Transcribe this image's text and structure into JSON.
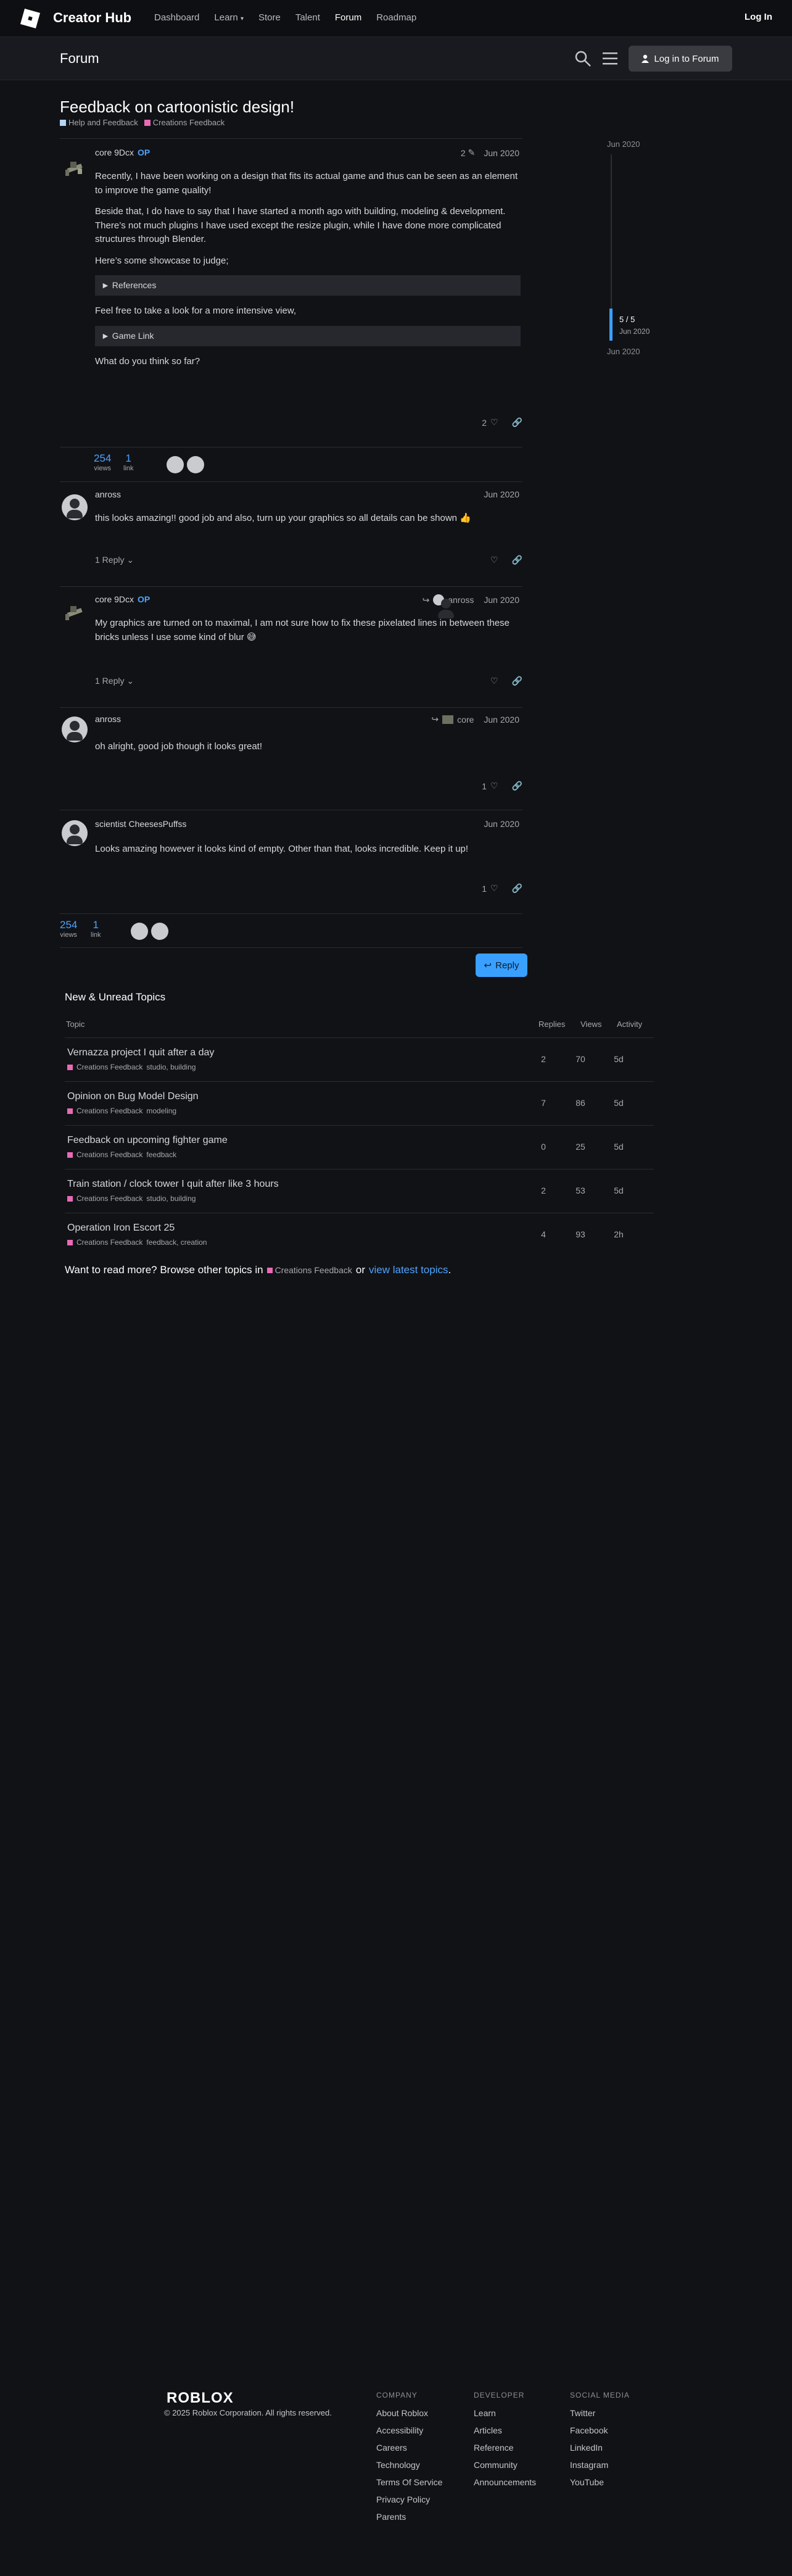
{
  "nav": {
    "brand": "Creator Hub",
    "links": [
      "Dashboard",
      "Learn",
      "Store",
      "Talent",
      "Forum",
      "Roadmap"
    ],
    "login": "Log In"
  },
  "forum_header": {
    "title": "Forum",
    "login_button": "Log in to Forum"
  },
  "topic": {
    "title": "Feedback on cartoonistic design!",
    "categories": [
      {
        "name": "Help and Feedback",
        "color": "#b3d4f5"
      },
      {
        "name": "Creations Feedback",
        "color": "#e86ab5"
      }
    ]
  },
  "posts": [
    {
      "author": "core 9Dcx",
      "op": "OP",
      "edits": "2",
      "date": "Jun 2020",
      "p1": "Recently, I have been working on a design that fits its actual game and thus can be seen as an element to improve the game quality!",
      "p2": "Beside that, I do have to say that I have started a month ago with building, modeling & development.",
      "p3": "There’s not much plugins I have used except the resize plugin, while I have done more complicated structures through Blender.",
      "p4": "Here’s some showcase to judge;",
      "details1": "References",
      "p5": "Feel free to take a look for a more intensive view,",
      "details2": "Game Link",
      "p6": "What do you think so far?",
      "likes": "2"
    },
    {
      "author": "anross",
      "date": "Jun 2020",
      "body": "this looks amazing!! good job and also, turn up your graphics so all details can be shown 👍",
      "replies": "1 Reply"
    },
    {
      "author": "core 9Dcx",
      "op": "OP",
      "reply_to": "anross",
      "date": "Jun 2020",
      "body": "My graphics are turned on to maximal, I am not sure how to fix these pixelated lines in between these bricks unless I use some kind of blur 😅",
      "replies": "1 Reply"
    },
    {
      "author": "anross",
      "reply_to": "core",
      "date": "Jun 2020",
      "body": "oh alright, good job though it looks great!",
      "likes": "1"
    },
    {
      "author": "scientist CheesesPuffss",
      "date": "Jun 2020",
      "body": "Looks amazing however it looks kind of empty. Other than that, looks incredible. Keep it up!",
      "likes": "1"
    }
  ],
  "topic_map": {
    "views": "254",
    "views_label": "views",
    "links": "1",
    "links_label": "link"
  },
  "reply_button": "Reply",
  "timeline": {
    "start": "Jun 2020",
    "count": "5 / 5",
    "count_date": "Jun 2020",
    "end": "Jun 2020"
  },
  "suggested": {
    "title": "New & Unread Topics",
    "headers": {
      "topic": "Topic",
      "replies": "Replies",
      "views": "Views",
      "activity": "Activity"
    },
    "rows": [
      {
        "title": "Vernazza project I quit after a day",
        "category": "Creations Feedback",
        "tags": "studio, building",
        "replies": "2",
        "views": "70",
        "activity": "5d"
      },
      {
        "title": "Opinion on Bug Model Design",
        "category": "Creations Feedback",
        "tags": "modeling",
        "replies": "7",
        "views": "86",
        "activity": "5d"
      },
      {
        "title": "Feedback on upcoming fighter game",
        "category": "Creations Feedback",
        "tags": "feedback",
        "replies": "0",
        "views": "25",
        "activity": "5d"
      },
      {
        "title": "Train station / clock tower I quit after like 3 hours",
        "category": "Creations Feedback",
        "tags": "studio, building",
        "replies": "2",
        "views": "53",
        "activity": "5d"
      },
      {
        "title": "Operation Iron Escort 25",
        "category": "Creations Feedback",
        "tags": "feedback, creation",
        "replies": "4",
        "views": "93",
        "activity": "2h"
      }
    ],
    "more_prefix": "Want to read more? Browse other topics in",
    "more_category": "Creations Feedback",
    "more_or": "or",
    "more_latest": "view latest topics",
    "more_dot": "."
  },
  "footer": {
    "logo": "ROBLOX",
    "copyright": "© 2025 Roblox Corporation. All rights reserved.",
    "company": {
      "heading": "COMPANY",
      "items": [
        "About Roblox",
        "Accessibility",
        "Careers",
        "Technology",
        "Terms Of Service",
        "Privacy Policy",
        "Parents"
      ]
    },
    "developer": {
      "heading": "DEVELOPER",
      "items": [
        "Learn",
        "Articles",
        "Reference",
        "Community",
        "Announcements"
      ]
    },
    "social": {
      "heading": "SOCIAL MEDIA",
      "items": [
        "Twitter",
        "Facebook",
        "LinkedIn",
        "Instagram",
        "YouTube"
      ]
    }
  }
}
